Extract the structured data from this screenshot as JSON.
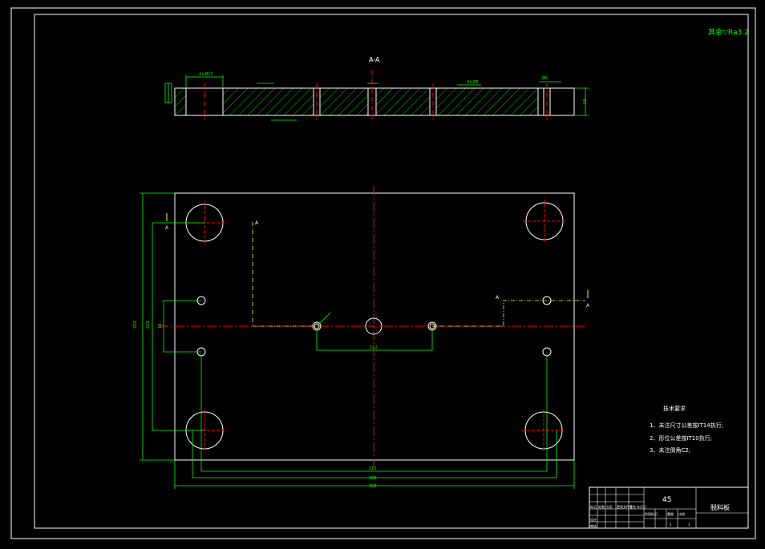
{
  "drawing": {
    "surface_note": "其余▽Ra3.2",
    "section_title": "A-A",
    "section_marks": [
      "A",
      "A",
      "A",
      "A"
    ],
    "dimensions": {
      "width_inner": "112",
      "width_mid": "212",
      "width_holes": "300",
      "width_total": "350",
      "height_small": "16",
      "height_mid": "215",
      "height_total": "250",
      "plate_thickness": "18",
      "pitch_label": "4×Ø12",
      "small_hole": "Ø6",
      "center_hole": "4×Ø8"
    },
    "tech_requirements": {
      "title": "技术要求",
      "items": [
        "1、未注尺寸公差按IT14执行;",
        "2、形位公差按IT10执行;",
        "3、未注倒角C2;"
      ]
    },
    "title_block": {
      "material": "45",
      "part_name": "脱料板",
      "row_labels": [
        "标记",
        "处数",
        "分区",
        "更改文件号",
        "签名",
        "年月日"
      ],
      "design_label": "设计",
      "check_label": "审核",
      "scale_label": "比例",
      "weight_label": "重量",
      "stage_label": "阶段标记",
      "sheet_values": [
        "1",
        "1"
      ]
    }
  },
  "colors": {
    "background": "#000000",
    "outline": "#ffffff",
    "dimension": "#00ff00",
    "centerline": "#ff0000",
    "hatch": "#00ff00",
    "section_line": "#ffff00"
  }
}
